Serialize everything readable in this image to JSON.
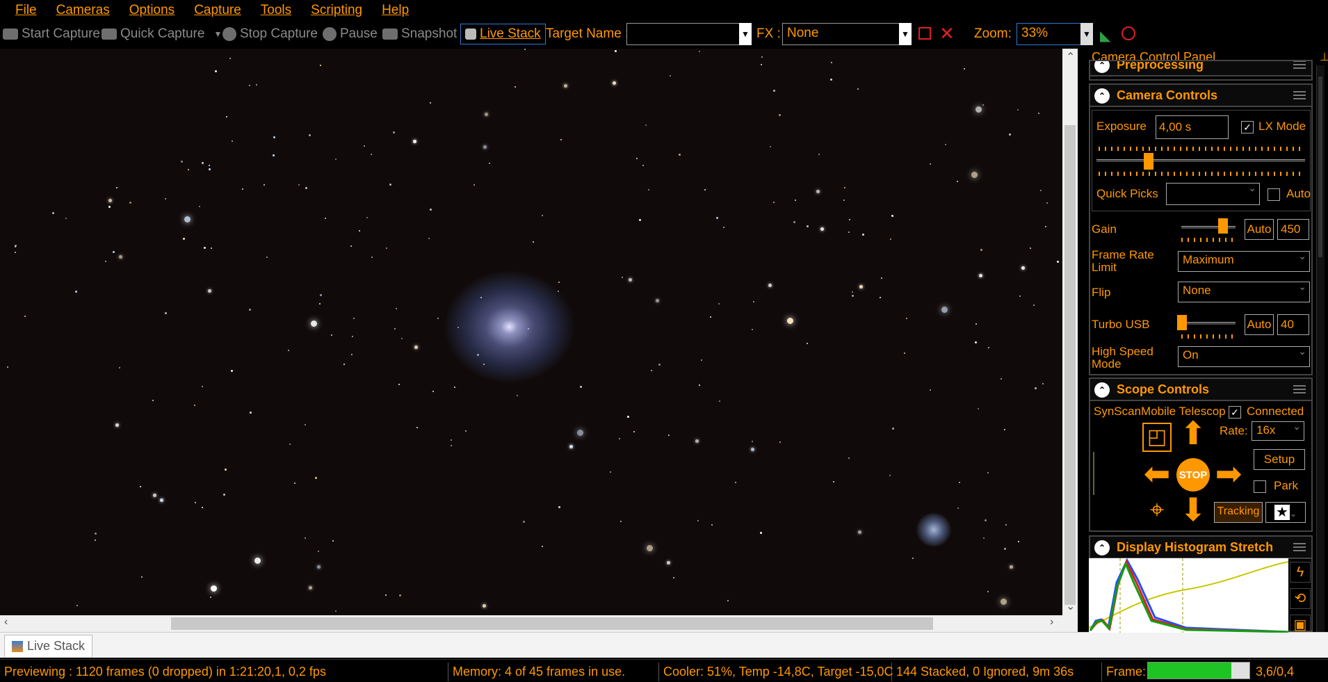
{
  "menu": [
    "File",
    "Cameras",
    "Options",
    "Capture",
    "Tools",
    "Scripting",
    "Help"
  ],
  "toolbar": {
    "start_capture": "Start Capture",
    "quick_capture": "Quick Capture",
    "stop_capture": "Stop Capture",
    "pause": "Pause",
    "snapshot": "Snapshot",
    "live_stack": "Live Stack",
    "target_name_label": "Target Name :",
    "target_name_value": "",
    "fx_label": "FX :",
    "fx_value": "None",
    "zoom_label": "Zoom:",
    "zoom_value": "33%"
  },
  "panel": {
    "title": "Camera Control Panel",
    "preprocessing": "Preprocessing",
    "camera_controls": {
      "title": "Camera Controls",
      "exposure_label": "Exposure",
      "exposure_value": "4,00 s",
      "lx_mode": "LX Mode",
      "lx_checked": true,
      "quick_picks": "Quick Picks",
      "auto": "Auto",
      "gain_label": "Gain",
      "gain_auto": "Auto",
      "gain_value": "450",
      "frame_rate_label_1": "Frame Rate",
      "frame_rate_label_2": "Limit",
      "frame_rate_value": "Maximum",
      "flip_label": "Flip",
      "flip_value": "None",
      "turbo_label": "Turbo USB",
      "turbo_auto": "Auto",
      "turbo_value": "40",
      "high_speed_label_1": "High Speed",
      "high_speed_label_2": "Mode",
      "high_speed_value": "On"
    },
    "scope_controls": {
      "title": "Scope Controls",
      "telescope": "SynScanMobile Telescope",
      "connected": "Connected",
      "connected_checked": true,
      "rate_label": "Rate:",
      "rate_value": "16x",
      "setup": "Setup",
      "park": "Park",
      "stop": "STOP",
      "tracking": "Tracking"
    },
    "histogram": {
      "title": "Display Histogram Stretch"
    }
  },
  "tab": {
    "label": "Live Stack"
  },
  "status": {
    "previewing": "Previewing : 1120 frames (0 dropped) in 1:21:20,1, 0,2 fps",
    "memory": "Memory: 4 of 45 frames in use.",
    "cooler": "Cooler: 51%, Temp -14,8C, Target -15,0C",
    "stacked": "144 Stacked, 0 Ignored, 9m 36s",
    "frame_label": "Frame:",
    "frame_progress": 0.82,
    "frame_value": "3,6/0,4"
  },
  "colors": {
    "accent": "#ff9800",
    "background": "#000000",
    "progress": "#1ec423"
  }
}
